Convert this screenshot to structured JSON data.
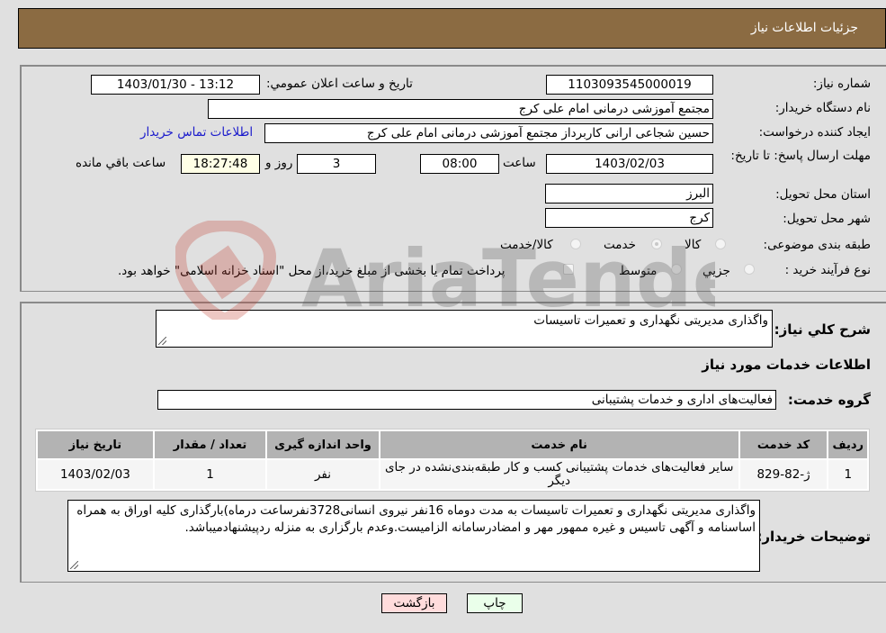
{
  "header": {
    "title": "جزئیات اطلاعات نیاز"
  },
  "form": {
    "need_number_label": "شماره نیاز:",
    "need_number": "1103093545000019",
    "announce_label": "تاریخ و ساعت اعلان عمومي:",
    "announce_value": "1403/01/30 - 13:12",
    "buyer_org_label": "نام دستگاه خريدار:",
    "buyer_org": "مجتمع آموزشی درمانی امام علی کرج",
    "creator_label": "ايجاد کننده درخواست:",
    "creator": "حسین شجاعی ارانی کاربرداز مجتمع آموزشی درمانی امام علی کرج",
    "contact_link": "اطلاعات تماس خريدار",
    "deadline_label": "مهلت ارسال پاسخ: تا تاريخ:",
    "deadline_date": "1403/02/03",
    "time_label": "ساعت",
    "deadline_time": "08:00",
    "days": "3",
    "days_label": "روز و",
    "remaining_time": "18:27:48",
    "remaining_label": "ساعت باقي مانده",
    "province_label": "استان محل تحويل:",
    "province": "البرز",
    "city_label": "شهر محل تحويل:",
    "city": "کرج",
    "category_label": "طبقه بندی موضوعی:",
    "category_options": [
      "کالا",
      "خدمت",
      "کالا/خدمت"
    ],
    "category_selected": "خدمت",
    "process_label": "نوع فرآيند خريد :",
    "process_options": [
      "جزيي",
      "متوسط"
    ],
    "treasury_note": "پرداخت تمام يا بخشی از مبلغ خريد،از محل \"اسناد خزانه اسلامی\" خواهد بود."
  },
  "details": {
    "summary_label": "شرح کلي نياز:",
    "summary": "واگذاری مدیریتی نگهداری و تعمیرات تاسیسات",
    "services_heading": "اطلاعات خدمات مورد نياز",
    "group_label": "گروه خدمت:",
    "group": "فعالیت‌های اداری و خدمات پشتیبانی",
    "table": {
      "headers": [
        "رديف",
        "کد خدمت",
        "نام خدمت",
        "واحد اندازه گيری",
        "تعداد / مقدار",
        "تاريخ نياز"
      ],
      "rows": [
        [
          "1",
          "ژ-82-829",
          "سایر فعالیت‌های خدمات پشتیبانی کسب و کار طبقه‌بندی‌نشده در جای دیگر",
          "نفر",
          "1",
          "1403/02/03"
        ]
      ]
    },
    "buyer_notes_label": "توضيحات خريدار:",
    "buyer_notes": "واگذاری مدیریتی نگهداری و تعمیرات تاسیسات به مدت دوماه 16نفر نیروی انسانی3728نفرساعت درماه)بارگذاری کلیه اوراق به همراه اساسنامه و آگهی تاسیس و غیره ممهور مهر و امضادرسامانه الزامیست.وعدم بارگزاری به منزله ردپیشنهادمیباشد."
  },
  "buttons": {
    "back": "بازگشت",
    "print": "چاپ"
  },
  "watermark": {
    "text": "AriaTender.neT"
  }
}
